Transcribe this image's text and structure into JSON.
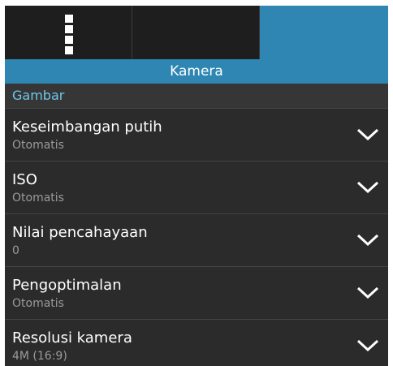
{
  "tabs": [
    {
      "icon": "more-icon",
      "selected": false
    },
    {
      "icon": "video-camera-icon",
      "selected": false
    },
    {
      "icon": "camera-icon",
      "selected": true
    }
  ],
  "header": {
    "title": "Kamera"
  },
  "section": {
    "label": "Gambar"
  },
  "settings": [
    {
      "title": "Keseimbangan putih",
      "value": "Otomatis"
    },
    {
      "title": "ISO",
      "value": "Otomatis"
    },
    {
      "title": "Nilai pencahayaan",
      "value": "0"
    },
    {
      "title": "Pengoptimalan",
      "value": "Otomatis"
    },
    {
      "title": "Resolusi kamera",
      "value": "4M (16:9)"
    }
  ],
  "colors": {
    "accent": "#2f86b3",
    "section_text": "#6ec6ea",
    "background": "#2b2b2b"
  }
}
